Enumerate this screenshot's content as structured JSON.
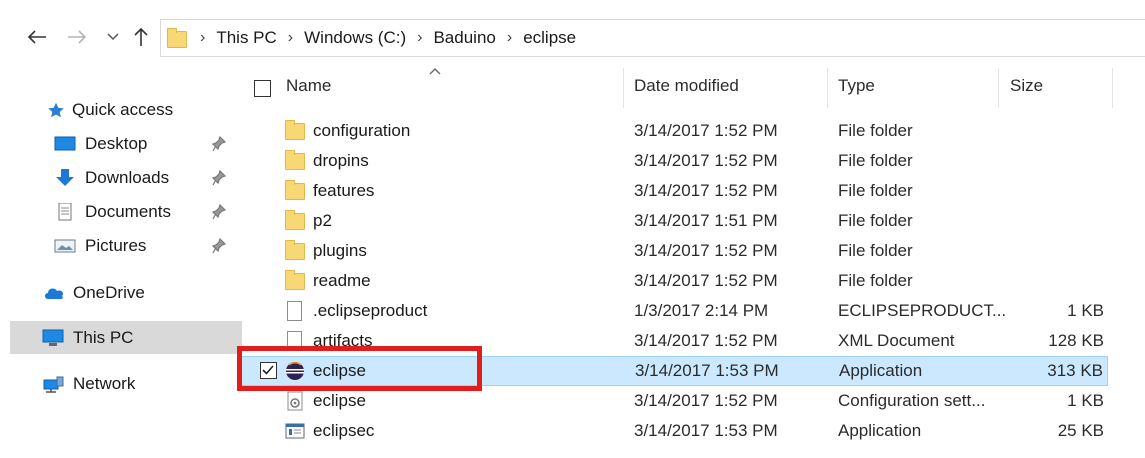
{
  "breadcrumb": [
    "This PC",
    "Windows (C:)",
    "Baduino",
    "eclipse"
  ],
  "sidebar": {
    "quick_access": "Quick access",
    "items": [
      {
        "label": "Desktop",
        "pinned": true
      },
      {
        "label": "Downloads",
        "pinned": true
      },
      {
        "label": "Documents",
        "pinned": true
      },
      {
        "label": "Pictures",
        "pinned": true
      }
    ],
    "onedrive": "OneDrive",
    "this_pc": "This PC",
    "network": "Network"
  },
  "columns": {
    "name": "Name",
    "date": "Date modified",
    "type": "Type",
    "size": "Size"
  },
  "files": [
    {
      "name": "configuration",
      "date": "3/14/2017 1:52 PM",
      "type": "File folder",
      "size": "",
      "icon": "folder-icon"
    },
    {
      "name": "dropins",
      "date": "3/14/2017 1:52 PM",
      "type": "File folder",
      "size": "",
      "icon": "folder-icon"
    },
    {
      "name": "features",
      "date": "3/14/2017 1:52 PM",
      "type": "File folder",
      "size": "",
      "icon": "folder-icon"
    },
    {
      "name": "p2",
      "date": "3/14/2017 1:51 PM",
      "type": "File folder",
      "size": "",
      "icon": "folder-icon"
    },
    {
      "name": "plugins",
      "date": "3/14/2017 1:52 PM",
      "type": "File folder",
      "size": "",
      "icon": "folder-icon"
    },
    {
      "name": "readme",
      "date": "3/14/2017 1:52 PM",
      "type": "File folder",
      "size": "",
      "icon": "folder-icon"
    },
    {
      "name": ".eclipseproduct",
      "date": "1/3/2017 2:14 PM",
      "type": "ECLIPSEPRODUCT...",
      "size": "1 KB",
      "icon": "file-icon"
    },
    {
      "name": "artifacts",
      "date": "3/14/2017 1:52 PM",
      "type": "XML Document",
      "size": "128 KB",
      "icon": "file-icon"
    },
    {
      "name": "eclipse",
      "date": "3/14/2017 1:53 PM",
      "type": "Application",
      "size": "313 KB",
      "icon": "eclipse-app-icon",
      "selected": true
    },
    {
      "name": "eclipse",
      "date": "3/14/2017 1:52 PM",
      "type": "Configuration sett...",
      "size": "1 KB",
      "icon": "config-file-icon"
    },
    {
      "name": "eclipsec",
      "date": "3/14/2017 1:53 PM",
      "type": "Application",
      "size": "25 KB",
      "icon": "console-app-icon"
    }
  ],
  "colors": {
    "selection": "#cce8ff",
    "annotation": "#e21d1d",
    "folder": "#f8d775"
  }
}
